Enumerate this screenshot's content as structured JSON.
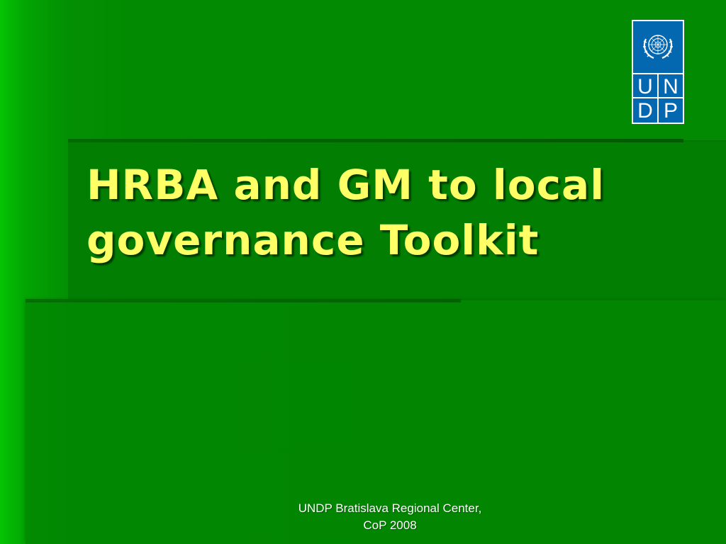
{
  "slide": {
    "title_lines": [
      "HRBA and GM to local",
      "governance Toolkit"
    ],
    "footer_lines": [
      "UNDP Bratislava Regional Center,",
      "CoP 2008"
    ]
  },
  "logo": {
    "icon": "undp-logo-icon",
    "emblem": "un-emblem-icon",
    "letters": [
      "U",
      "N",
      "D",
      "P"
    ],
    "color": "#0468b1"
  },
  "colors": {
    "background": "#028a02",
    "title_text": "#ffff66",
    "footer_text": "#ffffff"
  }
}
